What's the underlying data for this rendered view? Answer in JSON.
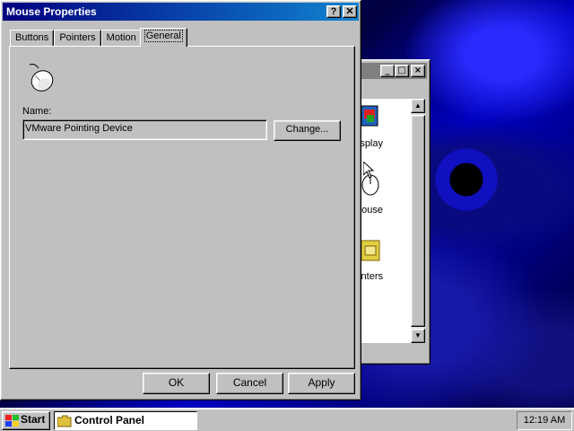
{
  "dialog": {
    "title": "Mouse Properties",
    "help_button": "?",
    "close_button": "✕",
    "tabs": [
      "Buttons",
      "Pointers",
      "Motion",
      "General"
    ],
    "active_tab": "General",
    "name_label": "Name:",
    "name_value": "VMware Pointing Device",
    "change_label": "Change...",
    "ok_label": "OK",
    "cancel_label": "Cancel",
    "apply_label": "Apply"
  },
  "control_panel": {
    "icons": [
      "splay",
      "louse",
      "inters"
    ]
  },
  "taskbar": {
    "start_label": "Start",
    "task_label": "Control Panel",
    "clock": "12:19 AM"
  }
}
